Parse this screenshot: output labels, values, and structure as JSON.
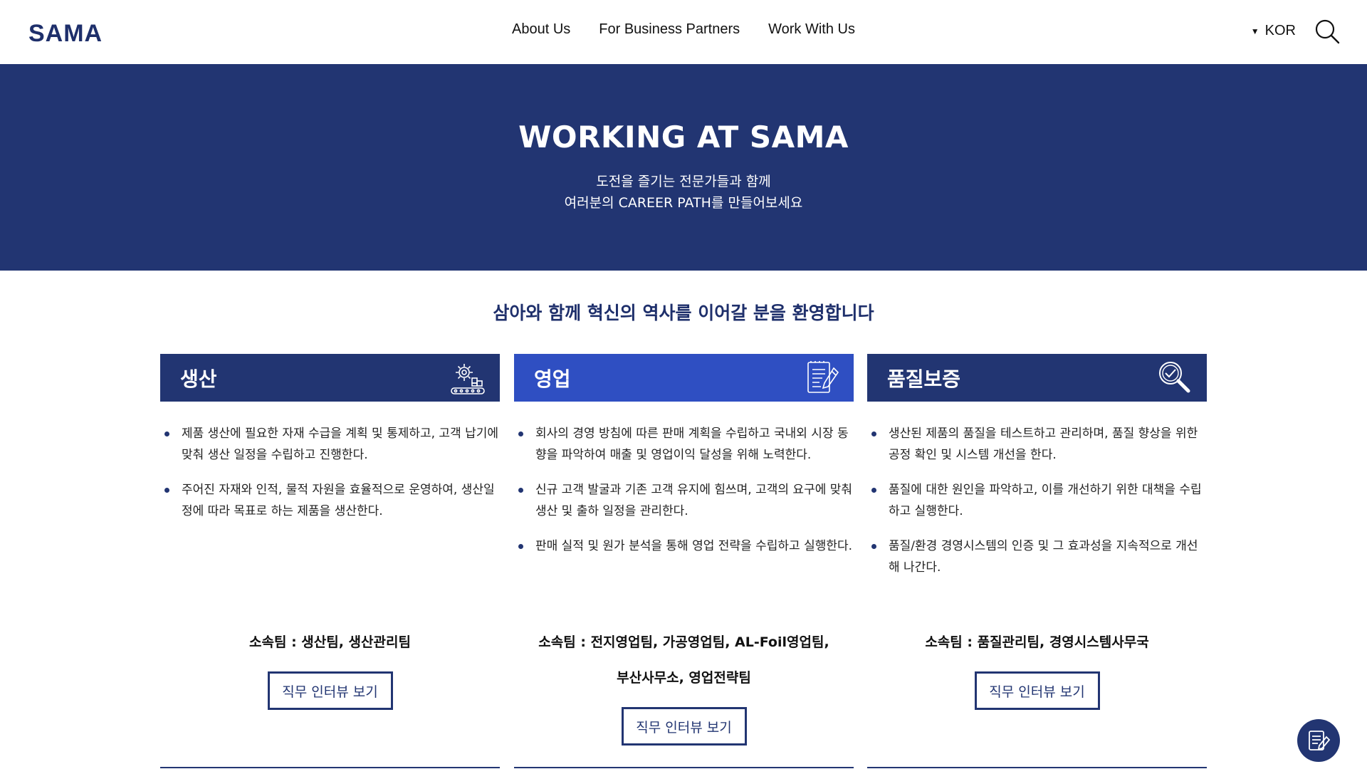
{
  "header": {
    "logo": "SAMA",
    "nav": [
      "About Us",
      "For Business Partners",
      "Work With Us"
    ],
    "language": "KOR"
  },
  "hero": {
    "title": "WORKING AT SAMA",
    "subtitle_line1": "도전을 즐기는 전문가들과 함께",
    "subtitle_line2": "여러분의 CAREER PATH를 만들어보세요"
  },
  "welcome": "삼아와 함께 혁신의 역사를 이어갈 분을 환영합니다",
  "columns": [
    {
      "title": "생산",
      "icon": "gear-conveyor-icon",
      "bullets": [
        "제품 생산에 필요한 자재 수급을 계획 및 통제하고, 고객 납기에 맞춰 생산 일정을 수립하고 진행한다.",
        "주어진 자재와 인적, 물적 자원을 효율적으로 운영하여, 생산일정에 따라 목표로 하는 제품을 생산한다."
      ],
      "team": "소속팀 : 생산팀, 생산관리팀",
      "button": "직무 인터뷰 보기"
    },
    {
      "title": "영업",
      "icon": "document-pen-icon",
      "bullets": [
        "회사의 경영 방침에 따른 판매 계획을 수립하고 국내외 시장 동향을 파악하여 매출 및 영업이익 달성을 위해 노력한다.",
        "신규 고객 발굴과 기존 고객 유지에 힘쓰며, 고객의 요구에 맞춰 생산 및 출하 일정을 관리한다.",
        "판매 실적 및 원가 분석을 통해 영업 전략을 수립하고 실행한다."
      ],
      "team_line1": "소속팀 : 전지영업팀, 가공영업팀, AL-Foil영업팀,",
      "team_line2": "부산사무소, 영업전략팀",
      "button": "직무 인터뷰 보기"
    },
    {
      "title": "품질보증",
      "icon": "magnifier-check-icon",
      "bullets": [
        "생산된 제품의 품질을 테스트하고 관리하며, 품질 향상을 위한 공정 확인 및 시스템 개선을 한다.",
        "품질에 대한 원인을 파악하고, 이를 개선하기 위한 대책을 수립하고 실행한다.",
        "품질/환경 경영시스템의 인증 및 그 효과성을 지속적으로 개선해 나간다."
      ],
      "team": "소속팀 : 품질관리팀, 경영시스템사무국",
      "button": "직무 인터뷰 보기"
    }
  ],
  "colors": {
    "navy": "#223572",
    "accent_blue": "#2f4fc2"
  }
}
